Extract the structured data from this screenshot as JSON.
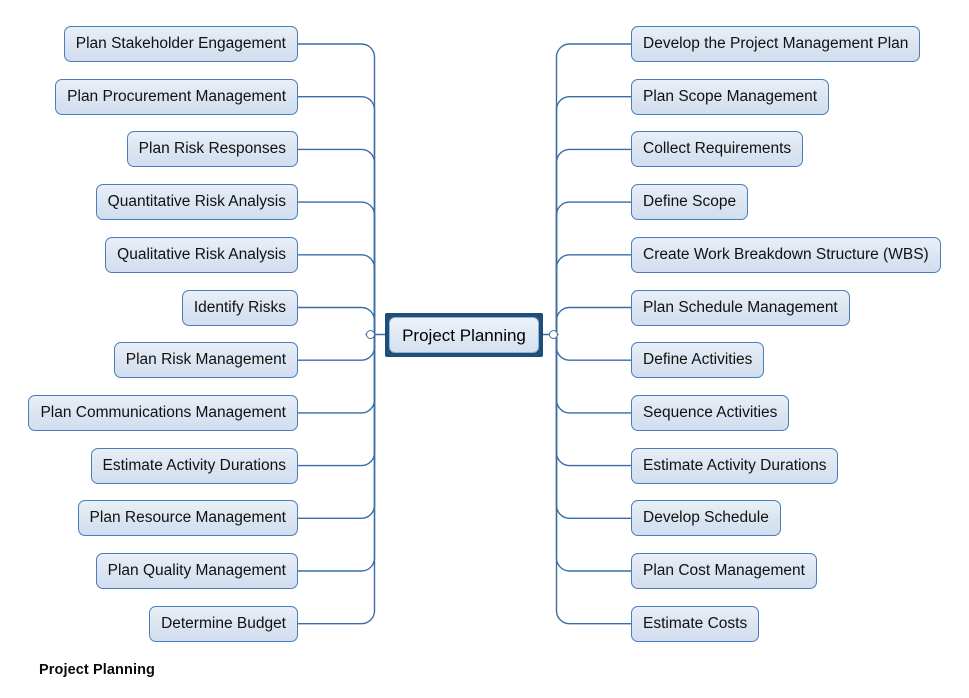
{
  "diagram": {
    "title": "Project Planning",
    "caption": "Project Planning",
    "type": "mind-map",
    "accent_color": "#4a7ebb",
    "center_border_color": "#1f4e79",
    "node_fill_color": "#dbe5f1",
    "connector_color": "#3a6ea5",
    "center": {
      "label": "Project Planning"
    },
    "left_branch": {
      "count": 12,
      "nodes": [
        {
          "label": "Plan Stakeholder Engagement"
        },
        {
          "label": "Plan Procurement Management"
        },
        {
          "label": "Plan Risk Responses"
        },
        {
          "label": "Quantitative Risk Analysis"
        },
        {
          "label": "Qualitative Risk Analysis"
        },
        {
          "label": "Identify Risks"
        },
        {
          "label": "Plan Risk Management"
        },
        {
          "label": "Plan Communications Management"
        },
        {
          "label": "Estimate Activity Durations"
        },
        {
          "label": "Plan Resource Management"
        },
        {
          "label": "Plan Quality Management"
        },
        {
          "label": "Determine Budget"
        }
      ]
    },
    "right_branch": {
      "count": 12,
      "nodes": [
        {
          "label": "Develop the Project Management Plan"
        },
        {
          "label": "Plan Scope Management"
        },
        {
          "label": "Collect Requirements"
        },
        {
          "label": "Define Scope"
        },
        {
          "label": "Create Work Breakdown Structure (WBS)"
        },
        {
          "label": "Plan Schedule Management"
        },
        {
          "label": "Define Activities"
        },
        {
          "label": "Sequence Activities"
        },
        {
          "label": "Estimate Activity Durations"
        },
        {
          "label": "Develop Schedule"
        },
        {
          "label": "Plan Cost Management"
        },
        {
          "label": "Estimate Costs"
        }
      ]
    }
  }
}
